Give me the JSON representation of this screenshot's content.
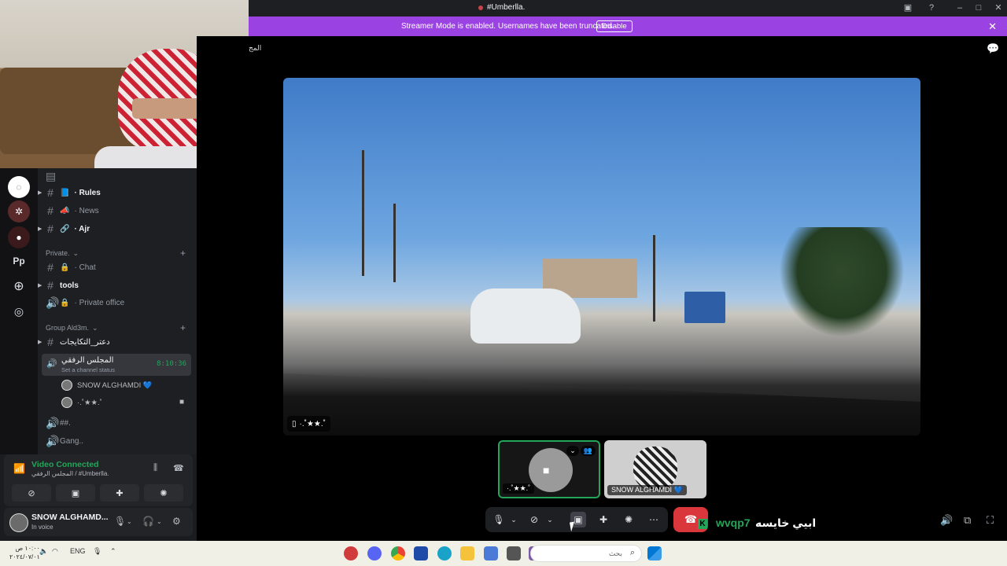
{
  "window": {
    "title": "#Umberlla."
  },
  "banner": {
    "text": "Streamer Mode is enabled. Usernames have been truncated.",
    "disable_label": "Disable"
  },
  "stage_top_text": "المج",
  "channels": {
    "top_items": [
      {
        "name": "Rules",
        "prefix": "· ",
        "emoji": "📘"
      },
      {
        "name": "News",
        "prefix": "· ",
        "emoji": "📣"
      },
      {
        "name": "Ajr",
        "prefix": "· ",
        "emoji": "🔗"
      }
    ],
    "private_category": "Private.",
    "private_items": [
      {
        "name": "Chat",
        "prefix": "· "
      },
      {
        "name": "tools"
      },
      {
        "name": "Private office",
        "prefix": "· "
      }
    ],
    "group_category": "Group Ald3m.",
    "group_items": [
      {
        "name": "دعتر_التكايجات"
      }
    ],
    "active_voice": {
      "name": "المجلس الرفقي",
      "status": "Set a channel status",
      "timer": "8:10:36"
    },
    "voice_users": [
      {
        "name": "SNOW ALGHAMDI 💙"
      },
      {
        "name": "·.˚★★.˚"
      }
    ],
    "more_items": [
      {
        "name": "##."
      },
      {
        "name": "Gang.."
      }
    ]
  },
  "voice_panel": {
    "status": "Video Connected",
    "location": "المجلس الرفقي / #Umberlla."
  },
  "user_panel": {
    "username": "SNOW ALGHAMD...",
    "status": "In voice"
  },
  "video_label": "·.˚★★.˚",
  "tiles": [
    {
      "label": "·.˚★★.˚"
    },
    {
      "label": "SNOW ALGHAMDI 💙"
    }
  ],
  "overlay": {
    "latin": "wvqp7",
    "arabic": "ابيي خايسه",
    "k": "K"
  },
  "taskbar": {
    "search_placeholder": "بحث",
    "lang": "ENG",
    "time": "١٠:٠٠ ص",
    "date": "٢٠٢٤/٠٧/٠١"
  },
  "icons": [
    "umbrella-icon",
    "hash-icon",
    "lock-icon",
    "speaker-icon",
    "mic-icon",
    "headset-icon",
    "gear-icon",
    "phone-hangup-icon",
    "screen-share-icon",
    "chat-icon"
  ]
}
